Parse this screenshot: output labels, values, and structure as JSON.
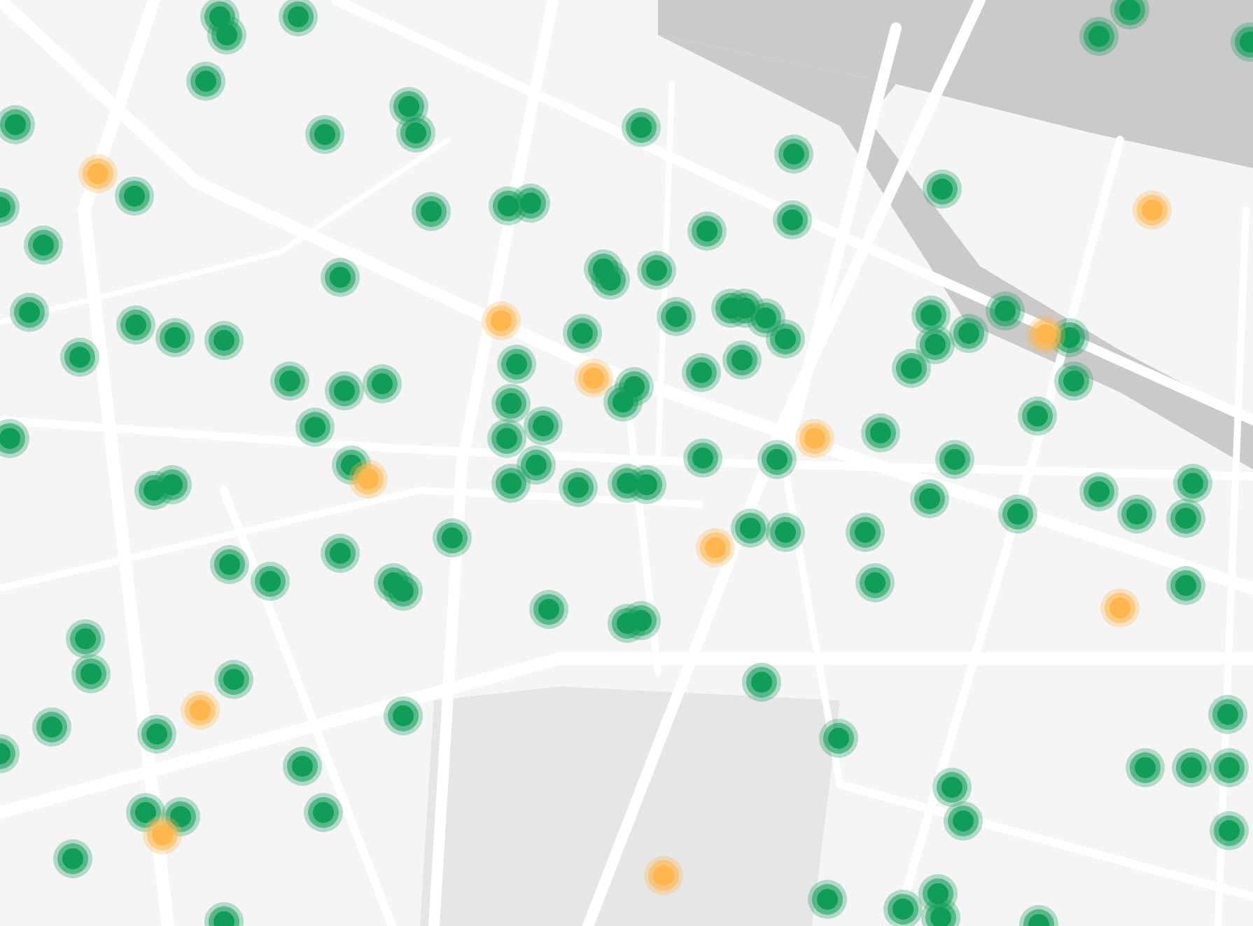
{
  "map": {
    "markers": [
      {
        "color": "#0f9d58"
      },
      {
        "color": "#0f9d58"
      },
      {
        "color": "#0f9d58"
      },
      {
        "color": "#0f9d58"
      },
      {
        "color": "#0f9d58"
      },
      {
        "color": "#0f9d58"
      },
      {
        "color": "#0f9d58"
      },
      {
        "color": "#0f9d58"
      },
      {
        "color": "#ffb74d"
      },
      {
        "color": "#0f9d58"
      },
      {
        "color": "#0f9d58"
      },
      {
        "color": "#0f9d58"
      },
      {
        "color": "#0f9d58"
      },
      {
        "color": "#0f9d58"
      },
      {
        "color": "#0f9d58"
      },
      {
        "color": "#0f9d58"
      },
      {
        "color": "#0f9d58"
      },
      {
        "color": "#0f9d58"
      },
      {
        "color": "#ffb74d"
      },
      {
        "color": "#0f9d58"
      },
      {
        "color": "#0f9d58"
      },
      {
        "color": "#0f9d58"
      },
      {
        "color": "#0f9d58"
      },
      {
        "color": "#0f9d58"
      },
      {
        "color": "#0f9d58"
      },
      {
        "color": "#0f9d58"
      },
      {
        "color": "#0f9d58"
      },
      {
        "color": "#0f9d58"
      },
      {
        "color": "#0f9d58"
      },
      {
        "color": "#0f9d58"
      },
      {
        "color": "#0f9d58"
      },
      {
        "color": "#ffb74d"
      },
      {
        "color": "#0f9d58"
      },
      {
        "color": "#0f9d58"
      },
      {
        "color": "#0f9d58"
      },
      {
        "color": "#0f9d58"
      },
      {
        "color": "#0f9d58"
      },
      {
        "color": "#0f9d58"
      },
      {
        "color": "#0f9d58"
      },
      {
        "color": "#0f9d58"
      },
      {
        "color": "#0f9d58"
      },
      {
        "color": "#0f9d58"
      },
      {
        "color": "#0f9d58"
      },
      {
        "color": "#0f9d58"
      },
      {
        "color": "#0f9d58"
      },
      {
        "color": "#0f9d58"
      },
      {
        "color": "#0f9d58"
      },
      {
        "color": "#0f9d58"
      },
      {
        "color": "#0f9d58"
      },
      {
        "color": "#0f9d58"
      },
      {
        "color": "#0f9d58"
      },
      {
        "color": "#0f9d58"
      },
      {
        "color": "#ffb74d"
      },
      {
        "color": "#0f9d58"
      },
      {
        "color": "#0f9d58"
      },
      {
        "color": "#0f9d58"
      },
      {
        "color": "#0f9d58"
      },
      {
        "color": "#0f9d58"
      },
      {
        "color": "#0f9d58"
      },
      {
        "color": "#ffb74d"
      },
      {
        "color": "#0f9d58"
      },
      {
        "color": "#0f9d58"
      },
      {
        "color": "#0f9d58"
      },
      {
        "color": "#0f9d58"
      },
      {
        "color": "#0f9d58"
      },
      {
        "color": "#ffb74d"
      },
      {
        "color": "#0f9d58"
      },
      {
        "color": "#0f9d58"
      },
      {
        "color": "#ffb74d"
      },
      {
        "color": "#0f9d58"
      },
      {
        "color": "#0f9d58"
      },
      {
        "color": "#0f9d58"
      },
      {
        "color": "#0f9d58"
      },
      {
        "color": "#0f9d58"
      },
      {
        "color": "#0f9d58"
      },
      {
        "color": "#0f9d58"
      },
      {
        "color": "#0f9d58"
      },
      {
        "color": "#0f9d58"
      },
      {
        "color": "#0f9d58"
      },
      {
        "color": "#0f9d58"
      },
      {
        "color": "#0f9d58"
      },
      {
        "color": "#0f9d58"
      },
      {
        "color": "#0f9d58"
      },
      {
        "color": "#0f9d58"
      },
      {
        "color": "#0f9d58"
      },
      {
        "color": "#ffb74d"
      },
      {
        "color": "#0f9d58"
      },
      {
        "color": "#0f9d58"
      },
      {
        "color": "#0f9d58"
      },
      {
        "color": "#0f9d58"
      },
      {
        "color": "#0f9d58"
      },
      {
        "color": "#0f9d58"
      },
      {
        "color": "#0f9d58"
      },
      {
        "color": "#ffb74d"
      },
      {
        "color": "#0f9d58"
      },
      {
        "color": "#0f9d58"
      },
      {
        "color": "#0f9d58"
      },
      {
        "color": "#0f9d58"
      },
      {
        "color": "#0f9d58"
      },
      {
        "color": "#0f9d58"
      },
      {
        "color": "#0f9d58"
      },
      {
        "color": "#0f9d58"
      },
      {
        "color": "#0f9d58"
      },
      {
        "color": "#ffb74d"
      },
      {
        "color": "#0f9d58"
      },
      {
        "color": "#0f9d58"
      },
      {
        "color": "#0f9d58"
      },
      {
        "color": "#0f9d58"
      },
      {
        "color": "#ffb74d"
      },
      {
        "color": "#0f9d58"
      },
      {
        "color": "#0f9d58"
      },
      {
        "color": "#0f9d58"
      },
      {
        "color": "#0f9d58"
      },
      {
        "color": "#0f9d58"
      },
      {
        "color": "#0f9d58"
      },
      {
        "color": "#0f9d58"
      },
      {
        "color": "#0f9d58"
      },
      {
        "color": "#0f9d58"
      },
      {
        "color": "#0f9d58"
      },
      {
        "color": "#0f9d58"
      },
      {
        "color": "#0f9d58"
      },
      {
        "color": "#0f9d58"
      },
      {
        "color": "#0f9d58"
      },
      {
        "color": "#ffb74d"
      },
      {
        "color": "#0f9d58"
      },
      {
        "color": "#0f9d58"
      },
      {
        "color": "#0f9d58"
      },
      {
        "color": "#0f9d58"
      },
      {
        "color": "#0f9d58"
      }
    ]
  }
}
